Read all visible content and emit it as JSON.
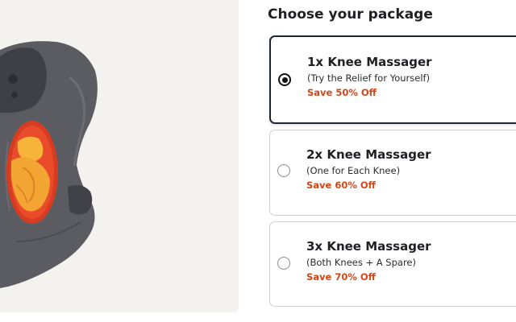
{
  "heading": "Choose your package",
  "product_image": {
    "icon": "knee-massager-image"
  },
  "options": [
    {
      "title": "1x Knee Massager",
      "subtitle": "(Try the Relief for Yourself)",
      "savings": "Save 50% Off",
      "selected": true
    },
    {
      "title": "2x Knee Massager",
      "subtitle": "(One for Each Knee)",
      "savings": "Save 60% Off",
      "selected": false
    },
    {
      "title": "3x Knee Massager",
      "subtitle": "(Both Knees + A Spare)",
      "savings": "Save 70% Off",
      "selected": false
    }
  ],
  "colors": {
    "savings": "#d2461a",
    "selected_border": "#1f2530",
    "panel_background": "#f3f2ef"
  }
}
